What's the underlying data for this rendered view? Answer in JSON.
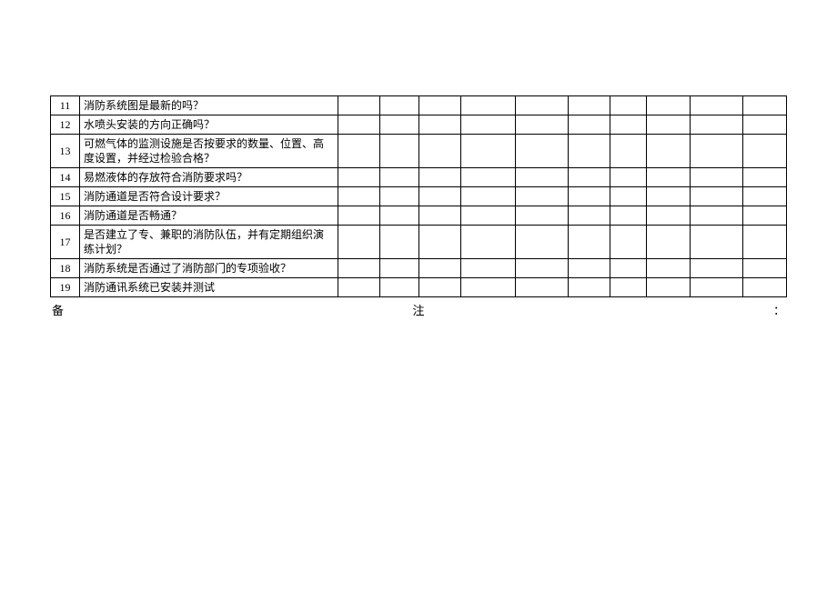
{
  "rows": [
    {
      "num": "11",
      "desc": "消防系统图是最新的吗？",
      "multi": false
    },
    {
      "num": "12",
      "desc": "水喷头安装的方向正确吗？",
      "multi": false
    },
    {
      "num": "13",
      "desc": "可燃气体的监测设施是否按要求的数量、位置、高度设置，并经过检验合格？",
      "multi": true
    },
    {
      "num": "14",
      "desc": "易燃液体的存放符合消防要求吗？",
      "multi": false
    },
    {
      "num": "15",
      "desc": "消防通道是否符合设计要求？",
      "multi": false
    },
    {
      "num": "16",
      "desc": "消防通道是否畅通？",
      "multi": false
    },
    {
      "num": "17",
      "desc": "是否建立了专、兼职的消防队伍，并有定期组织演练计划？",
      "multi": true
    },
    {
      "num": "18",
      "desc": "消防系统是否通过了消防部门的专项验收？",
      "multi": false
    },
    {
      "num": "19",
      "desc": "消防通讯系统已安装并测试",
      "multi": false
    }
  ],
  "footer": {
    "left": "备",
    "mid": "注",
    "right": "："
  }
}
